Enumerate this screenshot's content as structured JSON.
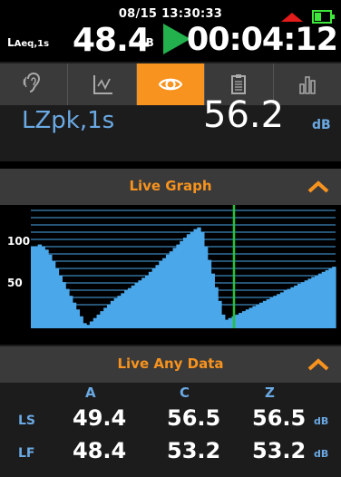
{
  "header": {
    "datetime": "08/15 13:30:33",
    "label_main": "LAeq,1s",
    "level": "48.4",
    "level_unit": "dB",
    "timer": "00:04:12"
  },
  "tabs": [
    {
      "icon": "ear-icon",
      "active": false
    },
    {
      "icon": "graph-icon",
      "active": false
    },
    {
      "icon": "eye-icon",
      "active": true
    },
    {
      "icon": "clipboard-icon",
      "active": false
    },
    {
      "icon": "bars-icon",
      "active": false
    }
  ],
  "zpk": {
    "label": "LZpk,1s",
    "value": "56.2",
    "unit": "dB"
  },
  "live_graph": {
    "title": "Live Graph",
    "y_ticks": [
      "100",
      "50"
    ],
    "colors": {
      "fill": "#4aa8ea",
      "cursor": "#27c23a",
      "grid": "#4aa8ea"
    }
  },
  "chart_data": {
    "type": "area",
    "title": "Live Graph",
    "xlabel": "",
    "ylabel": "",
    "ylim": [
      0,
      140
    ],
    "x": [
      0,
      2,
      4,
      6,
      8,
      10,
      12,
      14,
      16,
      18,
      20,
      22,
      24,
      26,
      28,
      30,
      32,
      34,
      36,
      38,
      40,
      42,
      44,
      46,
      48,
      50,
      52,
      54,
      56,
      58,
      60,
      62,
      64,
      66,
      68,
      70,
      72,
      74,
      76,
      78,
      80,
      82,
      84,
      86,
      88,
      90,
      92,
      94,
      96,
      98,
      100,
      102,
      104,
      106,
      108,
      110,
      112,
      114,
      116,
      118,
      120,
      122,
      124,
      126,
      128,
      130,
      132,
      134,
      136,
      138,
      140,
      142,
      144,
      146,
      148,
      150,
      152,
      154,
      156,
      158,
      160,
      162,
      164,
      166,
      168,
      170,
      172,
      174
    ],
    "series": [
      {
        "values": [
          95,
          96,
          98,
          96,
          92,
          86,
          78,
          70,
          62,
          54,
          46,
          38,
          30,
          22,
          14,
          6,
          4,
          8,
          12,
          16,
          20,
          24,
          28,
          32,
          35,
          38,
          41,
          44,
          47,
          50,
          53,
          56,
          59,
          62,
          66,
          70,
          74,
          78,
          82,
          86,
          90,
          94,
          98,
          102,
          106,
          110,
          113,
          116,
          118,
          112,
          96,
          80,
          64,
          48,
          32,
          16,
          10,
          12,
          14,
          16,
          18,
          20,
          22,
          24,
          26,
          28,
          30,
          32,
          34,
          36,
          38,
          40,
          42,
          44,
          46,
          48,
          50,
          52,
          54,
          56,
          58,
          60,
          62,
          64,
          66,
          68,
          70,
          72
        ]
      }
    ],
    "cursor_x": 116
  },
  "live_any": {
    "title": "Live Any Data",
    "columns": [
      "A",
      "C",
      "Z"
    ],
    "rows": [
      {
        "label": "LS",
        "values": [
          "49.4",
          "56.5",
          "56.5"
        ],
        "unit": "dB"
      },
      {
        "label": "LF",
        "values": [
          "48.4",
          "53.2",
          "53.2"
        ],
        "unit": "dB"
      }
    ]
  }
}
